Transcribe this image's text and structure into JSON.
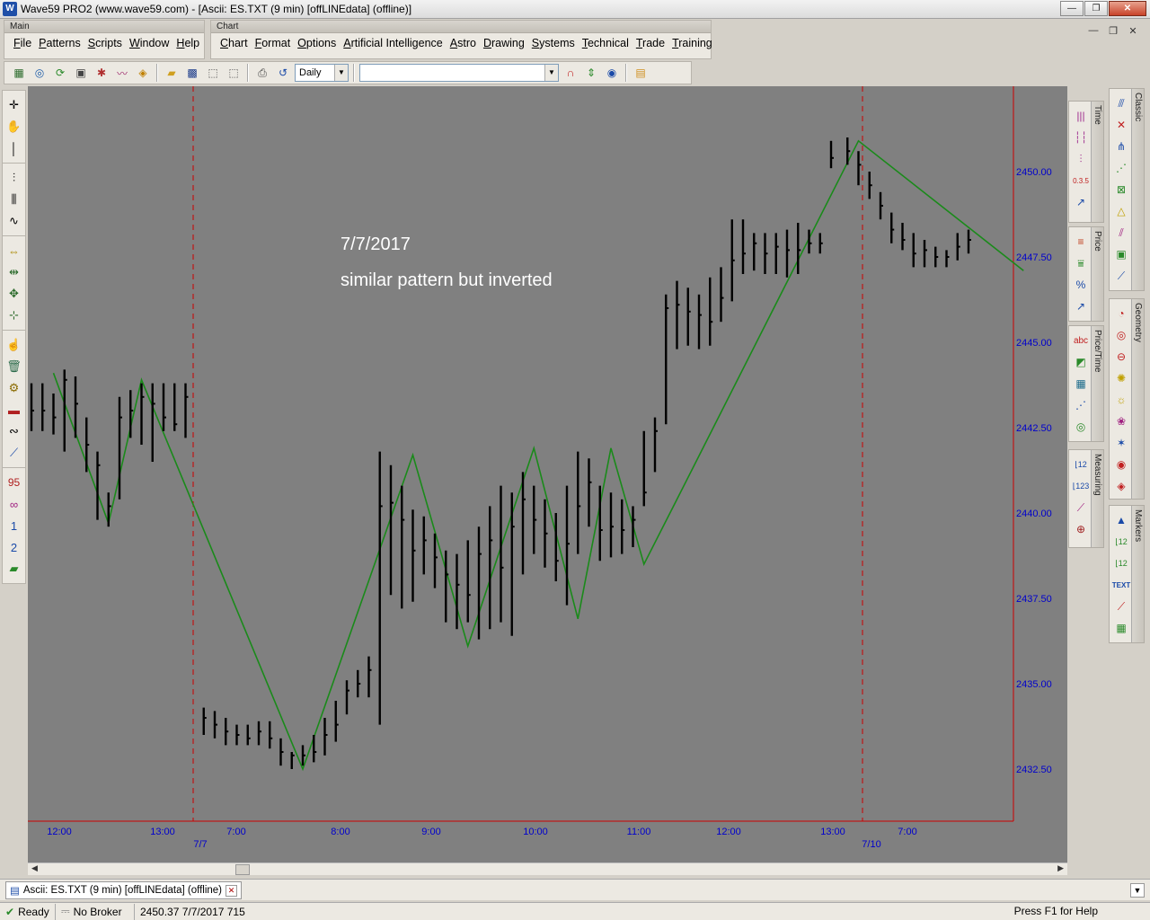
{
  "window": {
    "title": "Wave59 PRO2 (www.wave59.com) - [Ascii: ES.TXT (9 min) [offLINEdata] (offline)]",
    "app_icon": "W"
  },
  "menubars": {
    "main_caption": "Main",
    "main_items": [
      "File",
      "Patterns",
      "Scripts",
      "Window",
      "Help"
    ],
    "chart_caption": "Chart",
    "chart_items": [
      "Chart",
      "Format",
      "Options",
      "Artificial Intelligence",
      "Astro",
      "Drawing",
      "Systems",
      "Technical",
      "Trade",
      "Training"
    ]
  },
  "toolbar": {
    "period_value": "Daily",
    "symbol_value": ""
  },
  "chart": {
    "annotation_line1": "7/7/2017",
    "annotation_line2": "similar pattern but inverted",
    "price_labels": [
      "2450.00",
      "2447.50",
      "2445.00",
      "2442.50",
      "2440.00",
      "2437.50",
      "2435.00",
      "2432.50"
    ],
    "time_labels": [
      "12:00",
      "13:00",
      "7:00",
      "8:00",
      "9:00",
      "10:00",
      "11:00",
      "12:00",
      "13:00",
      "7:00"
    ],
    "date_labels": [
      "7/7",
      "7/10"
    ],
    "colors": {
      "background": "#808080",
      "bars": "#000000",
      "zigzag": "#1a8a1a",
      "axis_text": "#0000cc",
      "separator": "#cc0000"
    }
  },
  "chart_data": {
    "type": "ohlc",
    "y_axis": {
      "ylim": [
        2431,
        2451.5
      ],
      "ticks": [
        2432.5,
        2435,
        2437.5,
        2440,
        2442.5,
        2445,
        2447.5,
        2450
      ]
    },
    "bars": [
      [
        2443.8,
        2442.4,
        2443
      ],
      [
        2443.8,
        2442.4,
        2443
      ],
      [
        2443.5,
        2442.3,
        2442.8
      ],
      [
        2444.2,
        2441.8,
        2443.9
      ],
      [
        2444,
        2442.2,
        2443.2
      ],
      [
        2442.8,
        2441.2,
        2442
      ],
      [
        2441.8,
        2439.8,
        2441.4
      ],
      [
        2440.6,
        2439.6,
        2440.2
      ],
      [
        2443.4,
        2440.4,
        2442.8
      ],
      [
        2443.6,
        2442.2,
        2443
      ],
      [
        2443.8,
        2442,
        2443.4
      ],
      [
        2443.8,
        2441.5,
        2443.2
      ],
      [
        2443.8,
        2442.4,
        2442.8
      ],
      [
        2443.8,
        2442.4,
        2442.6
      ],
      [
        2443.8,
        2442.2,
        2443.4
      ],
      [
        2434.3,
        2433.5,
        2434
      ],
      [
        2434.2,
        2433.4,
        2433.8
      ],
      [
        2434.0,
        2433.2,
        2433.6
      ],
      [
        2433.8,
        2433.2,
        2433.5
      ],
      [
        2433.8,
        2433.2,
        2433.4
      ],
      [
        2433.9,
        2433.2,
        2433.6
      ],
      [
        2433.9,
        2433.1,
        2433.4
      ],
      [
        2433.4,
        2432.6,
        2433.0
      ],
      [
        2433.0,
        2432.5,
        2432.9
      ],
      [
        2433.2,
        2432.6,
        2432.9
      ],
      [
        2433.5,
        2432.7,
        2433.0
      ],
      [
        2434.0,
        2432.9,
        2433.5
      ],
      [
        2434.5,
        2433.3,
        2433.8
      ],
      [
        2435.1,
        2434.1,
        2434.8
      ],
      [
        2435.4,
        2434.6,
        2435.0
      ],
      [
        2435.8,
        2434.6,
        2435.4
      ],
      [
        2441.8,
        2433.8,
        2440.2
      ],
      [
        2441.4,
        2437.6,
        2440.3
      ],
      [
        2440.8,
        2437.2,
        2439.8
      ],
      [
        2440.1,
        2437.4,
        2438.9
      ],
      [
        2439.9,
        2438.2,
        2439.2
      ],
      [
        2439.4,
        2437.8,
        2438.7
      ],
      [
        2438.9,
        2436.8,
        2438.2
      ],
      [
        2438.8,
        2436.6,
        2437.9
      ],
      [
        2439.2,
        2436.8,
        2437.6
      ],
      [
        2439.6,
        2436.3,
        2438.8
      ],
      [
        2440.2,
        2436.6,
        2439.2
      ],
      [
        2440.8,
        2436.8,
        2438.4
      ],
      [
        2440.6,
        2436.4,
        2439.6
      ],
      [
        2441.2,
        2438.2,
        2440.4
      ],
      [
        2440.8,
        2438.8,
        2439.8
      ],
      [
        2440.4,
        2438.4,
        2439.4
      ],
      [
        2440.0,
        2438.0,
        2438.6
      ],
      [
        2440.8,
        2437.3,
        2439.1
      ],
      [
        2441.8,
        2438.8,
        2440.2
      ],
      [
        2441.6,
        2439.6,
        2440.9
      ],
      [
        2440.8,
        2438.6,
        2439.5
      ],
      [
        2440.6,
        2438.7,
        2439.6
      ],
      [
        2440.4,
        2438.8,
        2439.5
      ],
      [
        2440.2,
        2439.0,
        2439.8
      ],
      [
        2442.4,
        2440.2,
        2440.6
      ],
      [
        2442.8,
        2441.2,
        2442.4
      ],
      [
        2446.4,
        2442.6,
        2446.0
      ],
      [
        2446.8,
        2444.8,
        2446.1
      ],
      [
        2446.6,
        2444.9,
        2445.9
      ],
      [
        2446.4,
        2444.8,
        2445.8
      ],
      [
        2446.9,
        2444.9,
        2445.6
      ],
      [
        2447.2,
        2445.6,
        2446.3
      ],
      [
        2448.6,
        2446.2,
        2447.4
      ],
      [
        2448.6,
        2447.0,
        2447.6
      ],
      [
        2448.2,
        2447.1,
        2447.9
      ],
      [
        2448.2,
        2447.0,
        2447.6
      ],
      [
        2448.2,
        2447.0,
        2447.8
      ],
      [
        2448.3,
        2446.9,
        2447.7
      ],
      [
        2448.5,
        2447.0,
        2447.7
      ],
      [
        2448.3,
        2447.6,
        2447.9
      ],
      [
        2448.2,
        2447.6,
        2447.9
      ],
      [
        2450.9,
        2450.1,
        2450.4
      ],
      [
        2451.0,
        2450.2,
        2450.6
      ],
      [
        2450.6,
        2449.6,
        2450.2
      ],
      [
        2450.0,
        2449.2,
        2449.6
      ],
      [
        2449.4,
        2448.6,
        2449.0
      ],
      [
        2448.8,
        2447.9,
        2448.3
      ],
      [
        2448.5,
        2447.7,
        2448.0
      ],
      [
        2448.2,
        2447.2,
        2447.6
      ],
      [
        2448.0,
        2447.2,
        2447.7
      ],
      [
        2447.8,
        2447.2,
        2447.5
      ],
      [
        2447.7,
        2447.2,
        2447.5
      ],
      [
        2448.2,
        2447.4,
        2447.8
      ],
      [
        2448.3,
        2447.6,
        2448.0
      ]
    ],
    "zigzag": [
      [
        2,
        2444.1
      ],
      [
        7,
        2439.7
      ],
      [
        10,
        2443.9
      ],
      [
        24,
        2432.5
      ],
      [
        34,
        2441.7
      ],
      [
        39,
        2436.1
      ],
      [
        45,
        2441.9
      ],
      [
        49,
        2436.9
      ],
      [
        52,
        2441.9
      ],
      [
        55,
        2438.5
      ],
      [
        58,
        2440.4
      ],
      [
        74,
        2450.9
      ],
      [
        89,
        2447.1
      ]
    ]
  },
  "left_tools": [
    "crosshair-icon",
    "hand-icon",
    "line-icon",
    "bar-chart-icon",
    "candle-icon",
    "wave-icon",
    "vertical-split-icon",
    "horizontal-split-icon",
    "move-icon",
    "tick-icon",
    "pointer-icon",
    "trash-icon",
    "magic-icon",
    "car-icon",
    "loop-icon",
    "ruler-icon"
  ],
  "left_labels": [
    "95",
    "∞",
    "1",
    "2",
    ""
  ],
  "panels": {
    "time_tab": "Time",
    "price_tab": "Price",
    "price_time_tab": "Price/Time",
    "measuring_tab": "Measuring",
    "classic_tab": "Classic",
    "geometry_tab": "Geometry",
    "markers_tab": "Markers",
    "time_sample_label": "0.3.5",
    "percent_label": "%",
    "abc_label": "abc",
    "text_label": "TEXT"
  },
  "taskbar": {
    "tab_label": "Ascii: ES.TXT (9 min) [offLINEdata] (offline)"
  },
  "statusbar": {
    "ready": "Ready",
    "broker": "No Broker",
    "price_date": "2450.37  7/7/2017  715",
    "help": "Press F1 for Help"
  }
}
